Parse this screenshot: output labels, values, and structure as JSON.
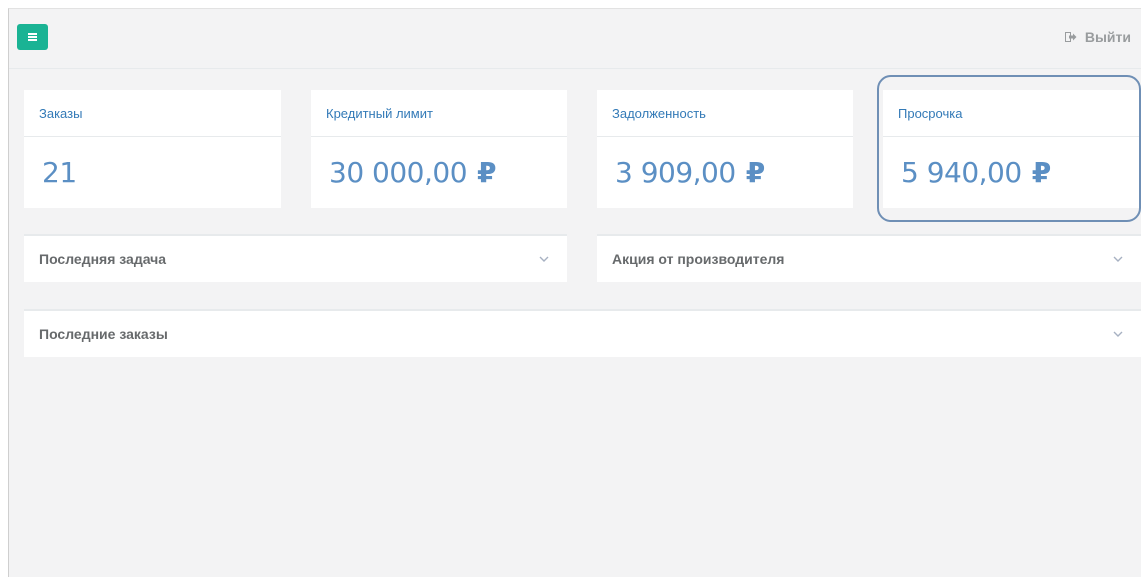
{
  "header": {
    "menu_icon": "bars-icon",
    "logout_label": "Выйти",
    "logout_icon": "sign-out-icon"
  },
  "stats": [
    {
      "label": "Заказы",
      "value": "21",
      "currency": ""
    },
    {
      "label": "Кредитный лимит",
      "value": "30 000,00",
      "currency": "₽"
    },
    {
      "label": "Задолженность",
      "value": "3 909,00",
      "currency": "₽"
    },
    {
      "label": "Просрочка",
      "value": "5 940,00",
      "currency": "₽"
    }
  ],
  "panels": {
    "last_task": "Последняя задача",
    "promo": "Акция от производителя",
    "last_orders": "Последние заказы",
    "collapse_icon": "chevron-down-icon"
  },
  "colors": {
    "accent": "#1ab394",
    "stat_label": "#337ab7",
    "stat_value": "#5b8fc4",
    "highlight": "#6f8fb5",
    "background": "#f3f3f4"
  }
}
